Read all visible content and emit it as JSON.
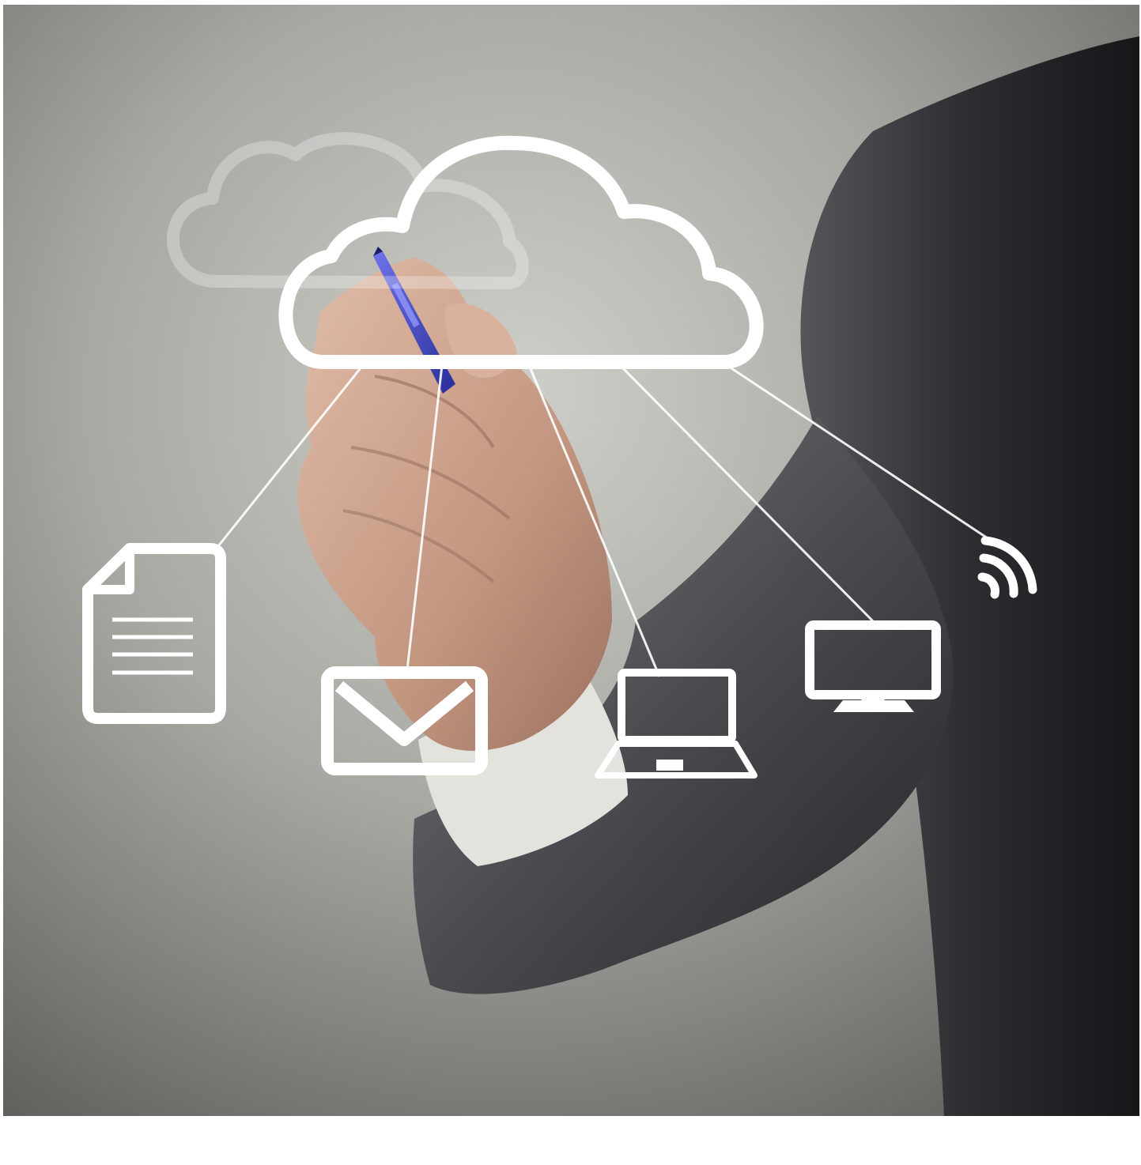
{
  "image": {
    "subject": "business-person-drawing-cloud-network",
    "icons": [
      "cloud-icon",
      "document-icon",
      "envelope-icon",
      "laptop-icon",
      "desktop-monitor-icon",
      "wifi-icon"
    ],
    "colors": {
      "background_light": "#c7c7c2",
      "background_dark": "#5a5a58",
      "suit": "#2a2b2d",
      "skin": "#c9a08a",
      "pen": "#3b3fc4",
      "line_art": "#ffffff"
    }
  }
}
